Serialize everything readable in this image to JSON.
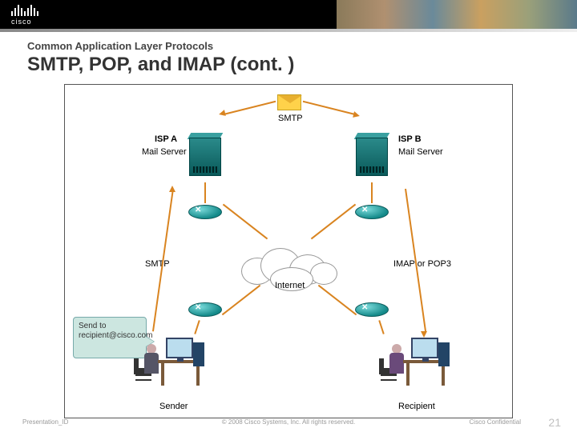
{
  "header": {
    "brand": "cisco",
    "eyebrow": "Common Application Layer Protocols",
    "title": "SMTP, POP, and IMAP (cont. )"
  },
  "diagram": {
    "top_protocol": "SMTP",
    "isp_a": {
      "name": "ISP A",
      "role": "Mail Server"
    },
    "isp_b": {
      "name": "ISP B",
      "role": "Mail Server"
    },
    "left_protocol": "SMTP",
    "right_protocol": "IMAP or POP3",
    "cloud_label": "Internet",
    "callout": "Send to recipient@cisco.com",
    "sender_label": "Sender",
    "recipient_label": "Recipient"
  },
  "footer": {
    "presentation_id": "Presentation_ID",
    "copyright": "© 2008 Cisco Systems, Inc. All rights reserved.",
    "confidential": "Cisco Confidential",
    "page": "21"
  }
}
